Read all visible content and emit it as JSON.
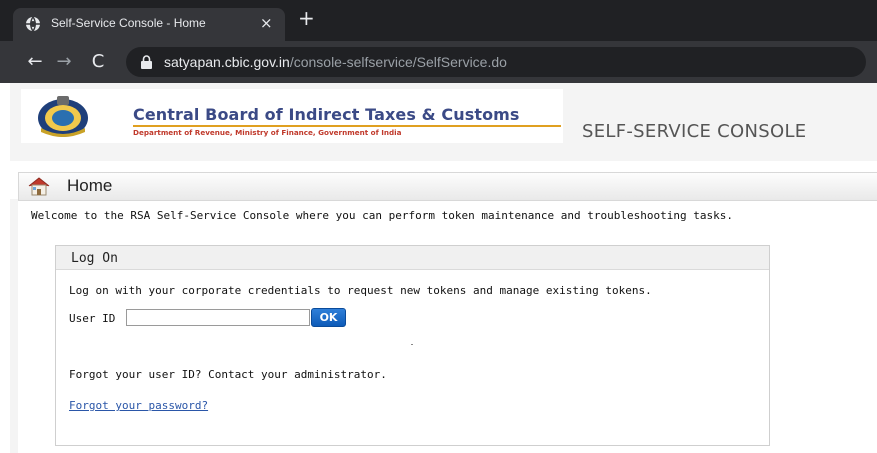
{
  "browser": {
    "tab_title": "Self-Service Console - Home",
    "tab_close": "×",
    "new_tab": "+",
    "back": "←",
    "forward": "→",
    "reload": "C",
    "url_host": "satyapan.cbic.gov.in",
    "url_path": "/console-selfservice/SelfService.do"
  },
  "header": {
    "logo_title": "Central Board of Indirect Taxes & Customs",
    "logo_subtitle": "Department of Revenue, Ministry of Finance, Government of India",
    "console_title": "SELF-SERVICE CONSOLE"
  },
  "home": {
    "title": "Home",
    "welcome": "Welcome to the RSA Self-Service Console where you can perform token maintenance and troubleshooting tasks."
  },
  "logon": {
    "title": "Log On",
    "instructions": "Log on with your corporate credentials to request new tokens and manage existing tokens.",
    "userid_label": "User ID",
    "userid_value": "",
    "ok_label": "OK",
    "forgot_id": "Forgot your user ID? Contact your administrator.",
    "forgot_password": "Forgot your password?"
  },
  "colors": {
    "browser_dark": "#202124",
    "browser_tab": "#35363a",
    "logo_blue": "#3b4a86",
    "logo_red": "#c0392b",
    "button_blue": "#0d5bb8",
    "link_blue": "#2a56a8"
  },
  "icons": [
    "globe-favicon-icon",
    "lock-icon",
    "emblem-logo",
    "home-icon"
  ]
}
